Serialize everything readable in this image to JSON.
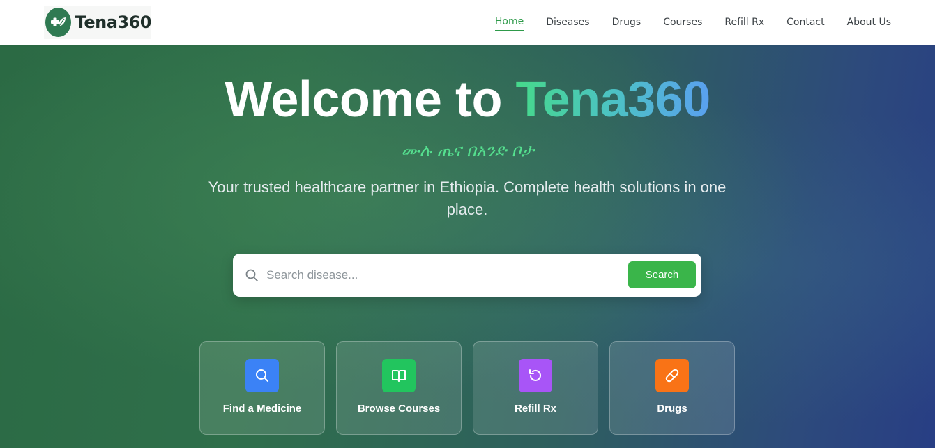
{
  "brand": {
    "name": "Tena360",
    "logo_icon": "leaf-cross-icon",
    "logo_color": "#2f7a52"
  },
  "nav": {
    "items": [
      {
        "label": "Home",
        "active": true
      },
      {
        "label": "Diseases"
      },
      {
        "label": "Drugs"
      },
      {
        "label": "Courses"
      },
      {
        "label": "Refill Rx"
      },
      {
        "label": "Contact"
      },
      {
        "label": "About Us"
      }
    ],
    "active_color": "#2e9a4a"
  },
  "hero": {
    "title_prefix": "Welcome to",
    "title_accent": "Tena360",
    "tagline": "ሙሉ ጤና በአንድ ቦታ",
    "subtitle": "Your trusted healthcare partner in Ethiopia. Complete health solutions in one place."
  },
  "search": {
    "placeholder": "Search disease...",
    "value": "",
    "button_label": "Search",
    "button_color": "#3ab54a",
    "icon": "search-icon"
  },
  "quick_actions": [
    {
      "label": "Find a Medicine",
      "icon": "search-icon",
      "color": "#3b82f6"
    },
    {
      "label": "Browse Courses",
      "icon": "book-open-icon",
      "color": "#22c55e"
    },
    {
      "label": "Refill Rx",
      "icon": "refresh-icon",
      "color": "#a855f7"
    },
    {
      "label": "Drugs",
      "icon": "pill-icon",
      "color": "#f97316"
    }
  ]
}
